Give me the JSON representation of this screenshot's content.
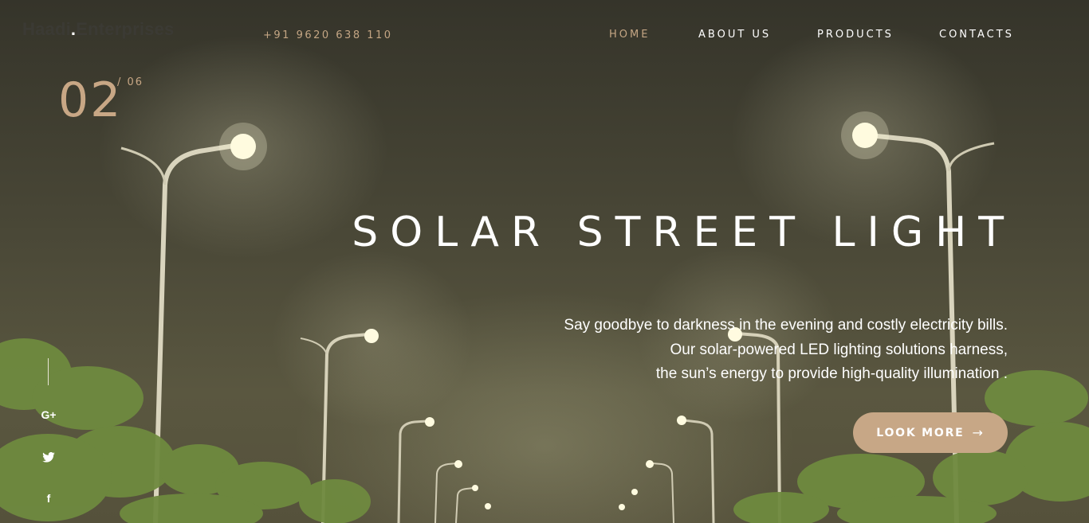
{
  "logo": {
    "name": "Haadi",
    "dot": ".",
    "rest": "Enterprises"
  },
  "header": {
    "phone": "+91 9620 638 110"
  },
  "nav": {
    "home": "HOME",
    "about": "ABOUT US",
    "products": "PRODUCTS",
    "contacts": "CONTACTS",
    "active": "home"
  },
  "slider": {
    "current": "02",
    "total": "/ 06"
  },
  "hero": {
    "title": "SOLAR STREET LIGHT",
    "description": [
      "Say goodbye to darkness in the evening and costly electricity bills.",
      "Our solar-powered LED lighting solutions harness,",
      "the sun’s energy to provide high-quality illumination ."
    ],
    "cta_label": "LOOK MORE",
    "cta_arrow": "→"
  },
  "social": {
    "google_plus": "G+",
    "twitter_icon": "twitter-icon",
    "facebook": "f"
  },
  "colors": {
    "accent": "#c7a786",
    "text": "#ffffff"
  }
}
